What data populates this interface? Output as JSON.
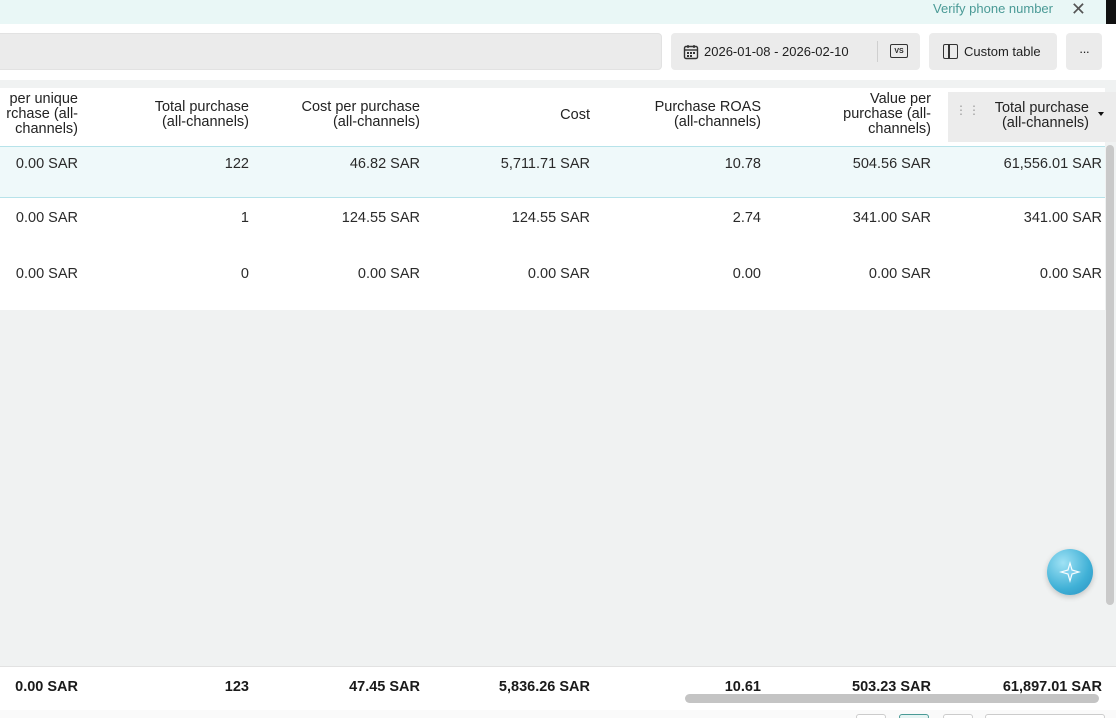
{
  "banner": {
    "verify_link": "Verify phone number",
    "close_label": "✕"
  },
  "toolbar": {
    "date_range": "2026-01-08 - 2026-02-10",
    "compare_label": "VS",
    "custom_table_label": "Custom table",
    "more_label": "···"
  },
  "table": {
    "columns": [
      {
        "line1": "per unique",
        "line2": "rchase (all-",
        "line3": "channels)"
      },
      {
        "line1": "Total purchase",
        "line2": "(all-channels)"
      },
      {
        "line1": "Cost per purchase",
        "line2": "(all-channels)"
      },
      {
        "line1": "Cost"
      },
      {
        "line1": "Purchase ROAS",
        "line2": "(all-channels)"
      },
      {
        "line1": "Value per",
        "line2": "purchase (all-",
        "line3": "channels)"
      },
      {
        "line1": "Total purchase",
        "line2": "(all-channels)"
      }
    ],
    "rows": [
      [
        "0.00 SAR",
        "122",
        "46.82 SAR",
        "5,711.71 SAR",
        "10.78",
        "504.56 SAR",
        "61,556.01 SAR"
      ],
      [
        "0.00 SAR",
        "1",
        "124.55 SAR",
        "124.55 SAR",
        "2.74",
        "341.00 SAR",
        "341.00 SAR"
      ],
      [
        "0.00 SAR",
        "0",
        "0.00 SAR",
        "0.00 SAR",
        "0.00",
        "0.00 SAR",
        "0.00 SAR"
      ]
    ],
    "totals": [
      "0.00 SAR",
      "123",
      "47.45 SAR",
      "5,836.26 SAR",
      "10.61",
      "503.23 SAR",
      "61,897.01 SAR"
    ]
  },
  "icons": {
    "calendar": "calendar-icon",
    "compare": "vs-icon",
    "table": "table-layout-icon",
    "more": "more-icon",
    "drag": "drag-handle-icon",
    "sort": "caret-down-icon",
    "assistant": "sparkle-icon"
  }
}
